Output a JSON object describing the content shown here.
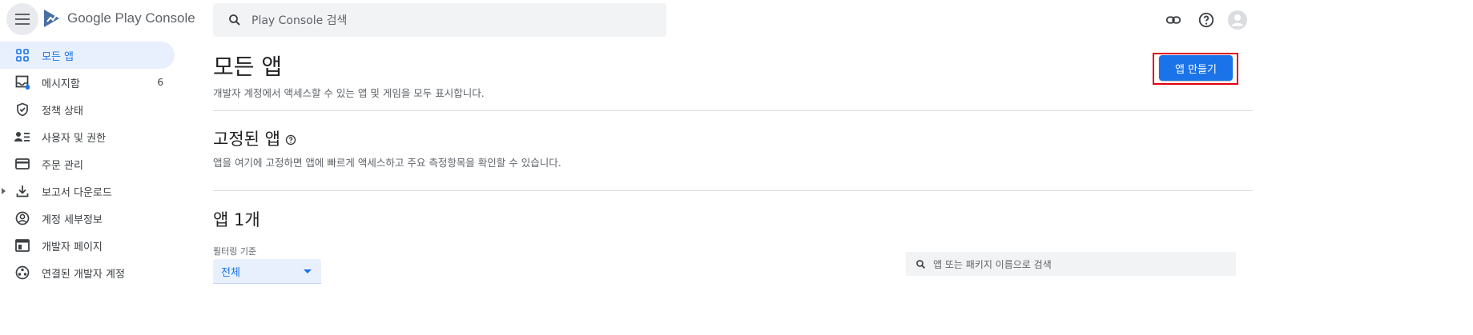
{
  "header": {
    "logo_text": "Google Play Console",
    "search_placeholder": "Play Console 검색"
  },
  "sidebar": {
    "items": [
      {
        "label": "모든 앱",
        "icon": "grid-icon",
        "active": true
      },
      {
        "label": "메시지함",
        "icon": "inbox-icon",
        "count": "6"
      },
      {
        "label": "정책 상태",
        "icon": "shield-check-icon"
      },
      {
        "label": "사용자 및 권한",
        "icon": "people-list-icon"
      },
      {
        "label": "주문 관리",
        "icon": "credit-card-icon"
      },
      {
        "label": "보고서 다운로드",
        "icon": "download-icon"
      },
      {
        "label": "계정 세부정보",
        "icon": "account-circle-icon"
      },
      {
        "label": "개발자 페이지",
        "icon": "web-page-icon"
      },
      {
        "label": "연결된 개발자 계정",
        "icon": "linked-accounts-icon"
      }
    ]
  },
  "main": {
    "title": "모든 앱",
    "subtitle": "개발자 계정에서 액세스할 수 있는 앱 및 게임을 모두 표시합니다.",
    "create_button": "앱 만들기",
    "pinned": {
      "title": "고정된 앱",
      "description": "앱을 여기에 고정하면 앱에 빠르게 액세스하고 주요 측정항목을 확인할 수 있습니다."
    },
    "apps": {
      "title": "앱 1개",
      "filter_label": "필터링 기준",
      "filter_value": "전체",
      "search_placeholder": "앱 또는 패키지 이름으로 검색"
    }
  },
  "colors": {
    "accent": "#1a73e8",
    "highlight_outline": "#e3000f",
    "active_nav_bg": "#e8f0fe"
  }
}
